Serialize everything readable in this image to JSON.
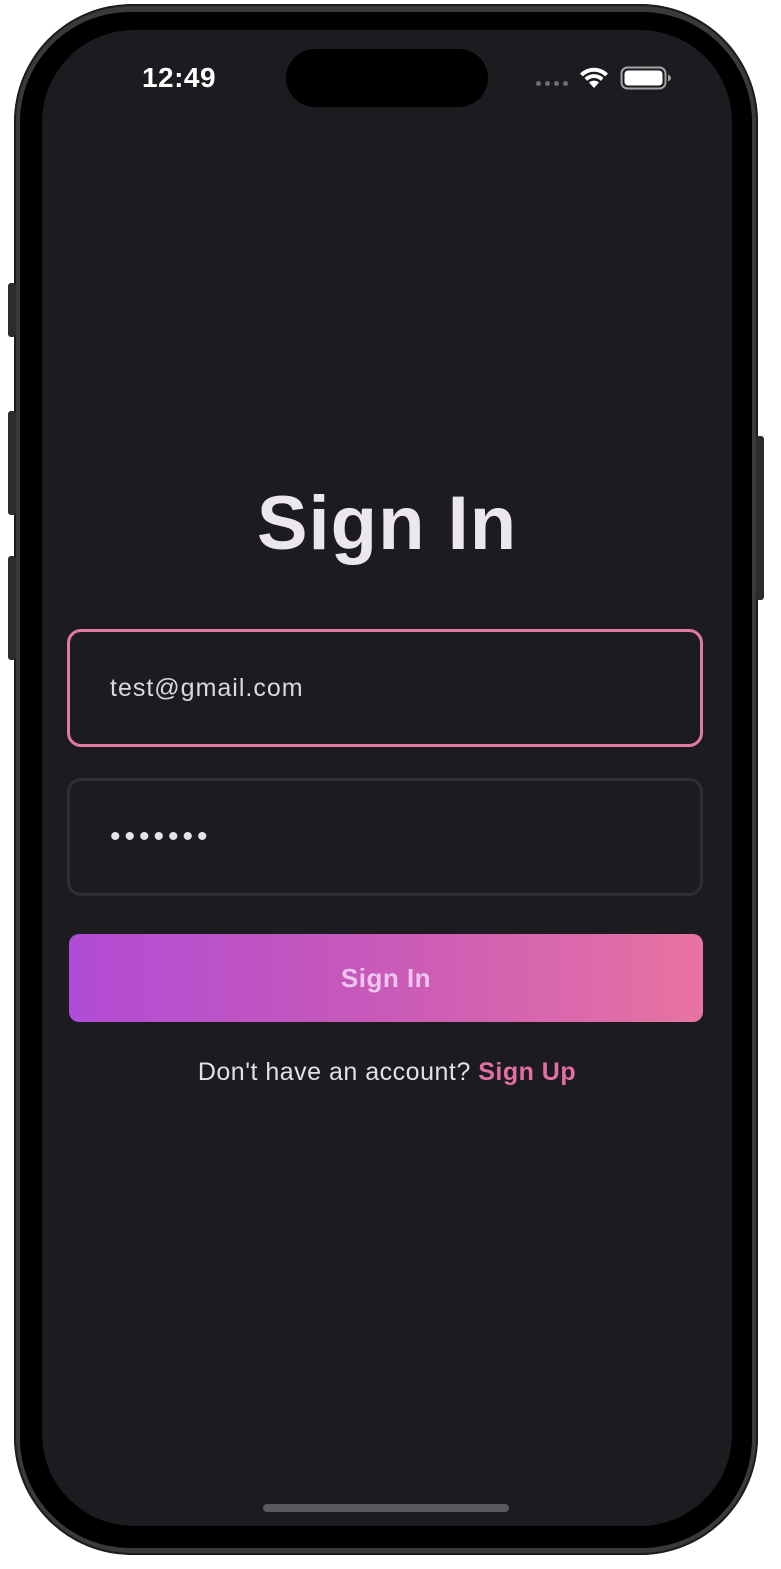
{
  "status_bar": {
    "time": "12:49",
    "wifi_icon": "wifi-icon",
    "battery_icon": "battery-icon",
    "signal_icon": "cellular-signal-icon"
  },
  "screen": {
    "title": "Sign In",
    "email_field": {
      "value": "test@gmail.com",
      "placeholder": ""
    },
    "password_field": {
      "value": "•••••••",
      "placeholder": ""
    },
    "signin_button_label": "Sign In",
    "signup_prompt": "Don't have an account?",
    "signup_link_label": "Sign Up"
  },
  "colors": {
    "background": "#1b1b20",
    "accent_pink": "#e36fa5",
    "gradient_start": "#b14bd6",
    "gradient_end": "#e873a2",
    "focused_border": "#e27aa6",
    "unfocused_border": "#2e2e38"
  }
}
